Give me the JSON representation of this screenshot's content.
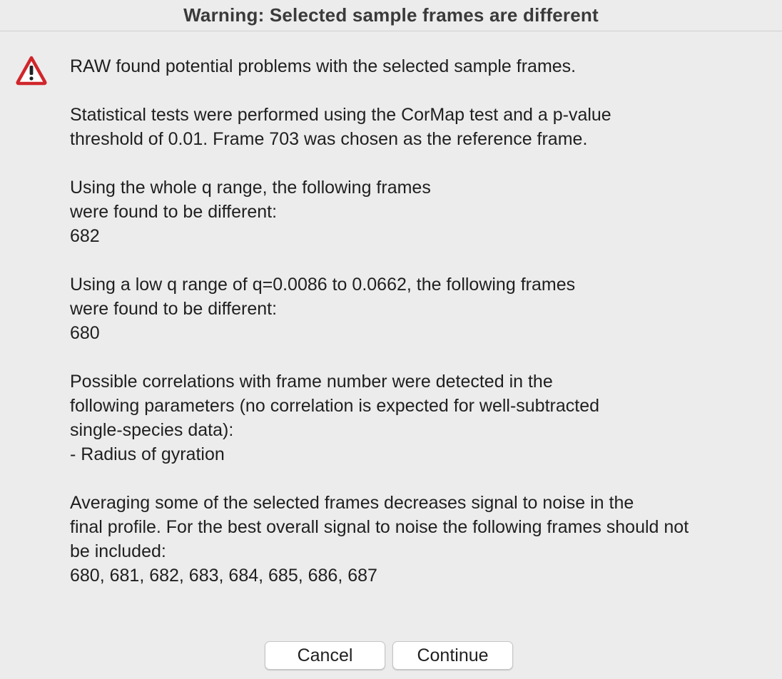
{
  "dialog": {
    "title": "Warning: Selected sample frames are different",
    "icon": "warning-triangle-icon",
    "paragraphs": [
      "RAW found potential problems with the selected sample frames.",
      "Statistical tests were performed using the CorMap test and a p-value\nthreshold of 0.01. Frame 703 was chosen as the reference frame.",
      "Using the whole q range, the following frames\nwere found to be different:\n682",
      "Using a low q range of q=0.0086 to 0.0662, the following frames\nwere found to be different:\n680",
      "Possible correlations with frame number were detected in the\nfollowing parameters (no correlation is expected for well-subtracted\nsingle-species data):\n- Radius of gyration",
      "Averaging some of the selected frames decreases signal to noise in the\nfinal profile. For the best overall signal to noise the following frames should not\nbe included:\n680, 681, 682, 683, 684, 685, 686, 687"
    ],
    "buttons": {
      "cancel": "Cancel",
      "continue": "Continue"
    }
  },
  "colors": {
    "background": "#ececec",
    "warning_red": "#d0262b",
    "button_bg": "#ffffff"
  }
}
